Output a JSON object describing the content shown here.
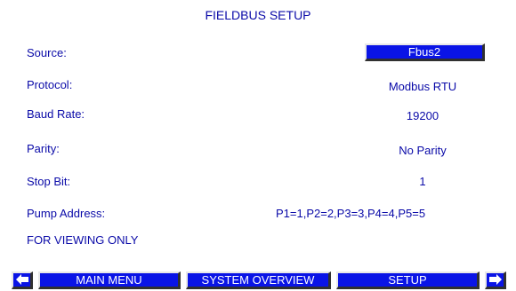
{
  "header": {
    "title": "FIELDBUS SETUP"
  },
  "settings": {
    "source_label": "Source:",
    "source_value": "Fbus2",
    "protocol_label": "Protocol:",
    "protocol_value": "Modbus RTU",
    "baud_label": "Baud Rate:",
    "baud_value": "19200",
    "parity_label": "Parity:",
    "parity_value": "No Parity",
    "stopbit_label": "Stop Bit:",
    "stopbit_value": "1",
    "pump_label": "Pump Address:",
    "pump_value": "P1=1,P2=2,P3=3,P4=4,P5=5"
  },
  "notice": "FOR VIEWING ONLY",
  "nav": {
    "prev_icon": "arrow-left-icon",
    "main_menu": "MAIN MENU",
    "system_overview": "SYSTEM OVERVIEW",
    "setup": "SETUP",
    "next_icon": "arrow-right-icon"
  },
  "colors": {
    "text": "#0a0aa8",
    "button_fill": "#0a14e6",
    "button_text": "#ffffff",
    "background": "#ffffff"
  }
}
